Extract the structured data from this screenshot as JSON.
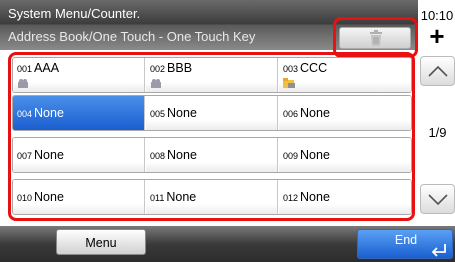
{
  "header": {
    "title": "System Menu/Counter.",
    "subtitle": "Address Book/One Touch - One Touch Key",
    "clock": "10:10"
  },
  "toolbar": {
    "delete_icon": "trash-icon",
    "add_label": "+"
  },
  "keys": [
    {
      "num": "001",
      "name": "AAA",
      "icon": "group-icon"
    },
    {
      "num": "002",
      "name": "BBB",
      "icon": "group-icon"
    },
    {
      "num": "003",
      "name": "CCC",
      "icon": "folder-icon"
    },
    {
      "num": "004",
      "name": "None",
      "selected": true
    },
    {
      "num": "005",
      "name": "None"
    },
    {
      "num": "006",
      "name": "None"
    },
    {
      "num": "007",
      "name": "None"
    },
    {
      "num": "008",
      "name": "None"
    },
    {
      "num": "009",
      "name": "None"
    },
    {
      "num": "010",
      "name": "None"
    },
    {
      "num": "011",
      "name": "None"
    },
    {
      "num": "012",
      "name": "None"
    }
  ],
  "pager": {
    "page": "1/9"
  },
  "footer": {
    "menu_label": "Menu",
    "end_label": "End"
  },
  "colors": {
    "highlight": "#e81010",
    "accent": "#1a5fd0"
  }
}
